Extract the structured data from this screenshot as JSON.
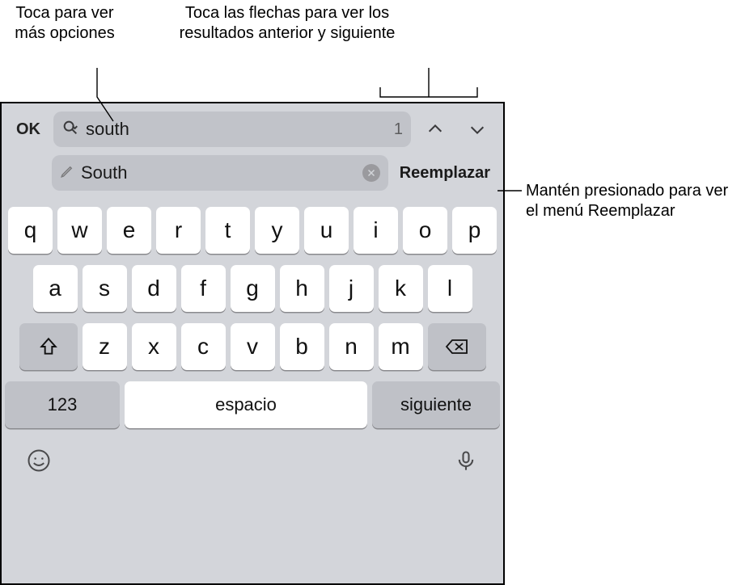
{
  "annotations": {
    "options": "Toca para ver más opciones",
    "arrows": "Toca las flechas para ver los resultados anterior y siguiente",
    "replace": "Mantén presionado para ver el menú Reemplazar"
  },
  "findbar": {
    "ok": "OK",
    "search_value": "south",
    "match_count": "1",
    "replace_value": "South",
    "replace_button": "Reemplazar"
  },
  "keyboard": {
    "row1": [
      "q",
      "w",
      "e",
      "r",
      "t",
      "y",
      "u",
      "i",
      "o",
      "p"
    ],
    "row2": [
      "a",
      "s",
      "d",
      "f",
      "g",
      "h",
      "j",
      "k",
      "l"
    ],
    "row3": [
      "z",
      "x",
      "c",
      "v",
      "b",
      "n",
      "m"
    ],
    "numbers_key": "123",
    "space_key": "espacio",
    "next_key": "siguiente"
  },
  "icons": {
    "search_options": "search-chevron-icon",
    "prev": "chevron-up-icon",
    "next": "chevron-down-icon",
    "pencil": "pencil-icon",
    "clear": "clear-icon",
    "shift": "shift-icon",
    "backspace": "backspace-icon",
    "emoji": "emoji-icon",
    "mic": "mic-icon"
  }
}
